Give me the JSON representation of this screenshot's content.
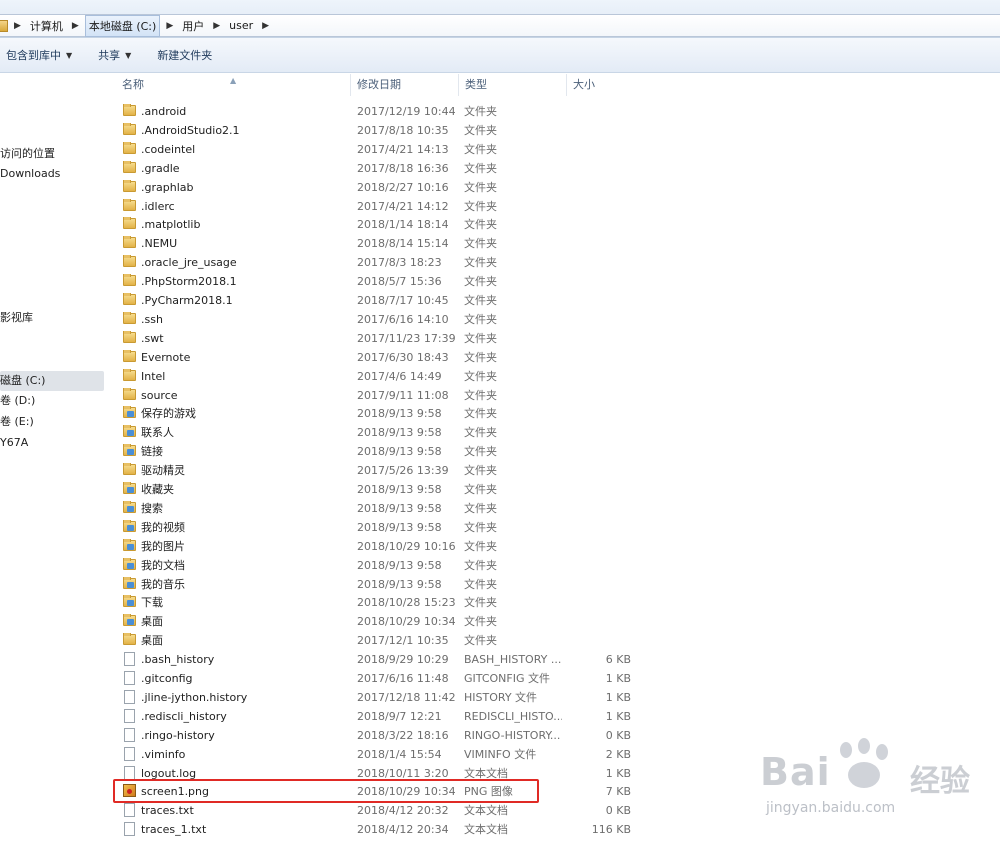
{
  "breadcrumb": [
    "计算机",
    "本地磁盘 (C:)",
    "用户",
    "user"
  ],
  "toolbar": {
    "include_library": "包含到库中",
    "share": "共享",
    "new_folder": "新建文件夹"
  },
  "nav": {
    "items": [
      {
        "label": "访问的位置"
      },
      {
        "label": "Downloads"
      },
      {
        "label": "影视库"
      },
      {
        "label": "磁盘 (C:)",
        "selected": true
      },
      {
        "label": "卷 (D:)"
      },
      {
        "label": "卷 (E:)"
      },
      {
        "label": "Y67A"
      }
    ]
  },
  "columns": {
    "name": "名称",
    "date": "修改日期",
    "type": "类型",
    "size": "大小"
  },
  "files": [
    {
      "name": ".android",
      "date": "2017/12/19 10:44",
      "type": "文件夹",
      "size": "",
      "icon": "folder-icon"
    },
    {
      "name": ".AndroidStudio2.1",
      "date": "2017/8/18 10:35",
      "type": "文件夹",
      "size": "",
      "icon": "folder-icon"
    },
    {
      "name": ".codeintel",
      "date": "2017/4/21 14:13",
      "type": "文件夹",
      "size": "",
      "icon": "folder-icon"
    },
    {
      "name": ".gradle",
      "date": "2017/8/18 16:36",
      "type": "文件夹",
      "size": "",
      "icon": "folder-icon"
    },
    {
      "name": ".graphlab",
      "date": "2018/2/27 10:16",
      "type": "文件夹",
      "size": "",
      "icon": "folder-icon"
    },
    {
      "name": ".idlerc",
      "date": "2017/4/21 14:12",
      "type": "文件夹",
      "size": "",
      "icon": "folder-icon"
    },
    {
      "name": ".matplotlib",
      "date": "2018/1/14 18:14",
      "type": "文件夹",
      "size": "",
      "icon": "folder-icon"
    },
    {
      "name": ".NEMU",
      "date": "2018/8/14 15:14",
      "type": "文件夹",
      "size": "",
      "icon": "folder-icon"
    },
    {
      "name": ".oracle_jre_usage",
      "date": "2017/8/3 18:23",
      "type": "文件夹",
      "size": "",
      "icon": "folder-icon"
    },
    {
      "name": ".PhpStorm2018.1",
      "date": "2018/5/7 15:36",
      "type": "文件夹",
      "size": "",
      "icon": "folder-icon"
    },
    {
      "name": ".PyCharm2018.1",
      "date": "2018/7/17 10:45",
      "type": "文件夹",
      "size": "",
      "icon": "folder-icon"
    },
    {
      "name": ".ssh",
      "date": "2017/6/16 14:10",
      "type": "文件夹",
      "size": "",
      "icon": "folder-icon"
    },
    {
      "name": ".swt",
      "date": "2017/11/23 17:39",
      "type": "文件夹",
      "size": "",
      "icon": "folder-icon"
    },
    {
      "name": "Evernote",
      "date": "2017/6/30 18:43",
      "type": "文件夹",
      "size": "",
      "icon": "folder-icon"
    },
    {
      "name": "Intel",
      "date": "2017/4/6 14:49",
      "type": "文件夹",
      "size": "",
      "icon": "folder-icon"
    },
    {
      "name": "source",
      "date": "2017/9/11 11:08",
      "type": "文件夹",
      "size": "",
      "icon": "folder-icon"
    },
    {
      "name": "保存的游戏",
      "date": "2018/9/13 9:58",
      "type": "文件夹",
      "size": "",
      "icon": "special-folder-icon"
    },
    {
      "name": "联系人",
      "date": "2018/9/13 9:58",
      "type": "文件夹",
      "size": "",
      "icon": "special-folder-icon"
    },
    {
      "name": "链接",
      "date": "2018/9/13 9:58",
      "type": "文件夹",
      "size": "",
      "icon": "special-folder-icon"
    },
    {
      "name": "驱动精灵",
      "date": "2017/5/26 13:39",
      "type": "文件夹",
      "size": "",
      "icon": "folder-icon"
    },
    {
      "name": "收藏夹",
      "date": "2018/9/13 9:58",
      "type": "文件夹",
      "size": "",
      "icon": "special-folder-icon"
    },
    {
      "name": "搜索",
      "date": "2018/9/13 9:58",
      "type": "文件夹",
      "size": "",
      "icon": "special-folder-icon"
    },
    {
      "name": "我的视频",
      "date": "2018/9/13 9:58",
      "type": "文件夹",
      "size": "",
      "icon": "special-folder-icon"
    },
    {
      "name": "我的图片",
      "date": "2018/10/29 10:16",
      "type": "文件夹",
      "size": "",
      "icon": "special-folder-icon"
    },
    {
      "name": "我的文档",
      "date": "2018/9/13 9:58",
      "type": "文件夹",
      "size": "",
      "icon": "special-folder-icon"
    },
    {
      "name": "我的音乐",
      "date": "2018/9/13 9:58",
      "type": "文件夹",
      "size": "",
      "icon": "special-folder-icon"
    },
    {
      "name": "下载",
      "date": "2018/10/28 15:23",
      "type": "文件夹",
      "size": "",
      "icon": "special-folder-icon"
    },
    {
      "name": "桌面",
      "date": "2018/10/29 10:34",
      "type": "文件夹",
      "size": "",
      "icon": "special-folder-icon"
    },
    {
      "name": "桌面",
      "date": "2017/12/1 10:35",
      "type": "文件夹",
      "size": "",
      "icon": "folder-icon"
    },
    {
      "name": ".bash_history",
      "date": "2018/9/29 10:29",
      "type": "BASH_HISTORY ...",
      "size": "6 KB",
      "icon": "file-icon"
    },
    {
      "name": ".gitconfig",
      "date": "2017/6/16 11:48",
      "type": "GITCONFIG 文件",
      "size": "1 KB",
      "icon": "file-icon"
    },
    {
      "name": ".jline-jython.history",
      "date": "2017/12/18 11:42",
      "type": "HISTORY 文件",
      "size": "1 KB",
      "icon": "file-icon"
    },
    {
      "name": ".rediscli_history",
      "date": "2018/9/7 12:21",
      "type": "REDISCLI_HISTO...",
      "size": "1 KB",
      "icon": "file-icon"
    },
    {
      "name": ".ringo-history",
      "date": "2018/3/22 18:16",
      "type": "RINGO-HISTORY...",
      "size": "0 KB",
      "icon": "file-icon"
    },
    {
      "name": ".viminfo",
      "date": "2018/1/4 15:54",
      "type": "VIMINFO 文件",
      "size": "2 KB",
      "icon": "file-icon"
    },
    {
      "name": "logout.log",
      "date": "2018/10/11 3:20",
      "type": "文本文档",
      "size": "1 KB",
      "icon": "file-icon"
    },
    {
      "name": "screen1.png",
      "date": "2018/10/29 10:34",
      "type": "PNG 图像",
      "size": "7 KB",
      "icon": "image-file-icon",
      "highlighted": true
    },
    {
      "name": "traces.txt",
      "date": "2018/4/12 20:32",
      "type": "文本文档",
      "size": "0 KB",
      "icon": "file-icon"
    },
    {
      "name": "traces_1.txt",
      "date": "2018/4/12 20:34",
      "type": "文本文档",
      "size": "116 KB",
      "icon": "file-icon"
    }
  ],
  "watermark": {
    "brand": "Bai",
    "brand_cn": "经验",
    "url": "jingyan.baidu.com"
  }
}
